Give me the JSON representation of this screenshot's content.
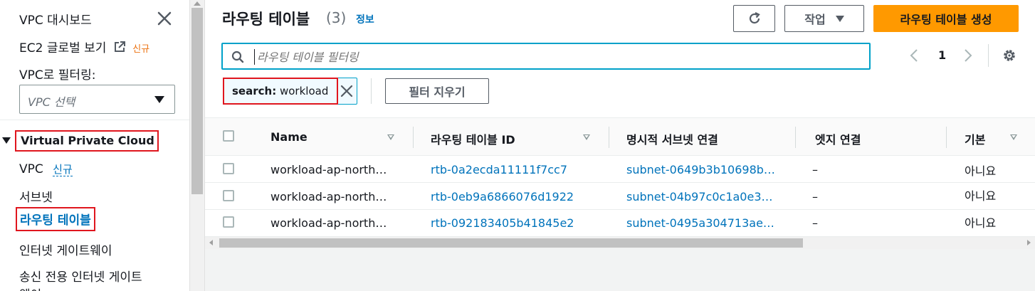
{
  "sidebar": {
    "dashboard": "VPC 대시보드",
    "ec2_global": "EC2 글로벌 보기",
    "ec2_global_badge": "신규",
    "filter_label": "VPC로 필터링:",
    "vpc_select_placeholder": "VPC 선택",
    "section_title": "Virtual Private Cloud",
    "items": [
      {
        "label": "VPC",
        "badge": "신규"
      },
      {
        "label": "서브넷"
      },
      {
        "label": "라우팅 테이블"
      },
      {
        "label": "인터넷 게이트웨이"
      },
      {
        "label": "송신 전용 인터넷 게이트"
      },
      {
        "label": "웨이"
      }
    ]
  },
  "main": {
    "title": "라우팅 테이블",
    "count": "(3)",
    "info": "정보",
    "actions_label": "작업",
    "create_label": "라우팅 테이블 생성",
    "filter_placeholder": "라우팅 테이블 필터링",
    "page_number": "1",
    "token_key": "search:",
    "token_value": "workload",
    "clear_filters": "필터 지우기",
    "columns": [
      "Name",
      "라우팅 테이블 ID",
      "명시적 서브넷 연결",
      "엣지 연결",
      "기본"
    ],
    "rows": [
      {
        "name": "workload-ap-north…",
        "id": "rtb-0a2ecda11111f7cc7",
        "subnet": "subnet-0649b3b10698b…",
        "edge": "–",
        "main": "아니요"
      },
      {
        "name": "workload-ap-north…",
        "id": "rtb-0eb9a6866076d1922",
        "subnet": "subnet-04b97c0c1a0e3…",
        "edge": "–",
        "main": "아니요"
      },
      {
        "name": "workload-ap-north…",
        "id": "rtb-092183405b41845e2",
        "subnet": "subnet-0495a304713ae…",
        "edge": "–",
        "main": "아니요"
      }
    ]
  },
  "colors": {
    "accent_blue": "#0073bb",
    "create_orange": "#ff9900",
    "highlight_red": "#e0161e",
    "focus_cyan": "#00a1c9"
  },
  "icons": [
    "close-icon",
    "external-link-icon",
    "caret-down-icon",
    "refresh-icon",
    "search-icon",
    "chevron-left-icon",
    "chevron-right-icon",
    "gear-icon",
    "dismiss-icon",
    "sort-icon"
  ]
}
